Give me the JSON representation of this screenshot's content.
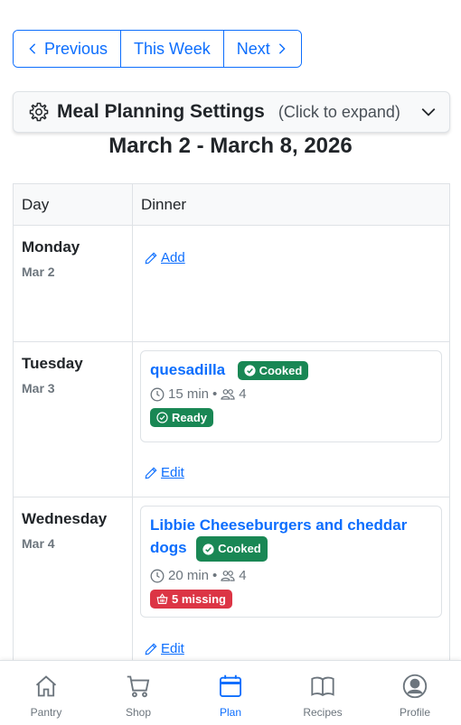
{
  "week_nav": {
    "previous": "Previous",
    "this_week": "This Week",
    "next": "Next"
  },
  "settings": {
    "title": "Meal Planning Settings",
    "hint": "(Click to expand)"
  },
  "week_title": "March 2 - March 8, 2026",
  "table": {
    "headers": [
      "Day",
      "Dinner"
    ],
    "rows": [
      {
        "day": "Monday",
        "date": "Mar 2",
        "action": "Add"
      },
      {
        "day": "Tuesday",
        "date": "Mar 3",
        "action": "Edit",
        "meal": {
          "title": "quesadilla",
          "status": "Cooked",
          "time": "15 min",
          "servings": "4",
          "availability": "Ready",
          "availability_color": "#198754"
        }
      },
      {
        "day": "Wednesday",
        "date": "Mar 4",
        "action": "Edit",
        "meal": {
          "title": "Libbie Cheeseburgers and cheddar dogs",
          "status": "Cooked",
          "time": "20 min",
          "servings": "4",
          "availability": "5 missing",
          "availability_color": "#dc3545"
        }
      }
    ]
  },
  "bottom_nav": [
    {
      "label": "Pantry",
      "icon": "house-icon"
    },
    {
      "label": "Shop",
      "icon": "cart-icon"
    },
    {
      "label": "Plan",
      "icon": "calendar-icon",
      "active": true
    },
    {
      "label": "Recipes",
      "icon": "book-icon"
    },
    {
      "label": "Profile",
      "icon": "person-circle-icon"
    }
  ],
  "colors": {
    "primary": "#0d6efd",
    "success": "#198754",
    "danger": "#dc3545",
    "muted": "#6c757d"
  }
}
